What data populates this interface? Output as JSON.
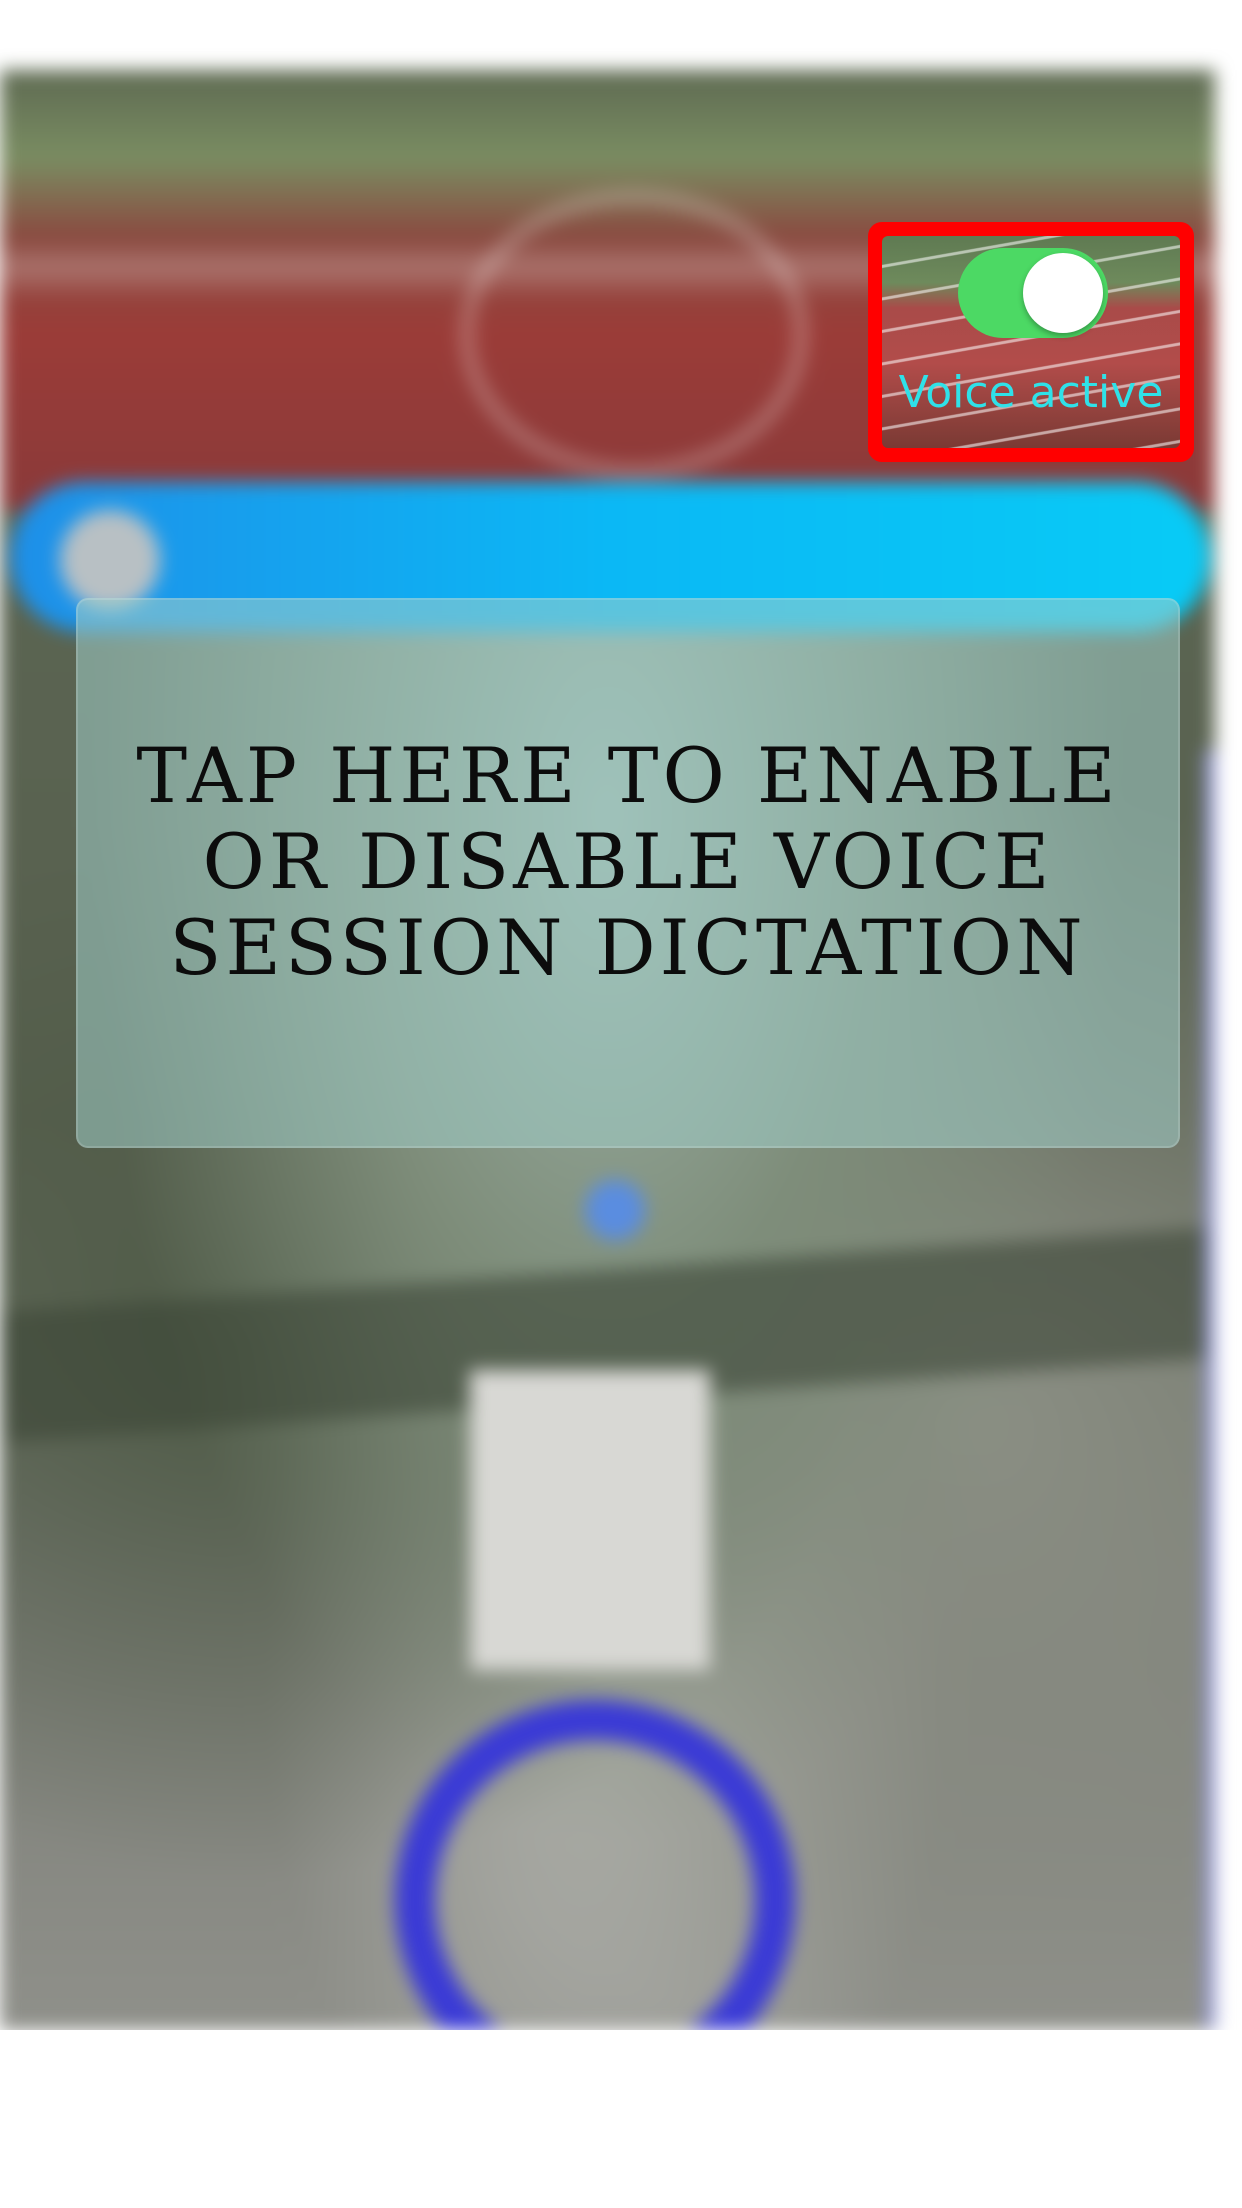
{
  "tutorial": {
    "message": "TAP HERE TO ENABLE OR DISABLE VOICE SESSION DICTATION"
  },
  "voice_control": {
    "label": "Voice active",
    "toggle_on": true,
    "toggle_color": "#4cd964",
    "label_color": "#2fe1e8",
    "highlight_color": "#ff0000"
  },
  "background": {
    "header_bar_color": "#0bb8f5",
    "progress_ring_color": "#3a3ad6"
  }
}
